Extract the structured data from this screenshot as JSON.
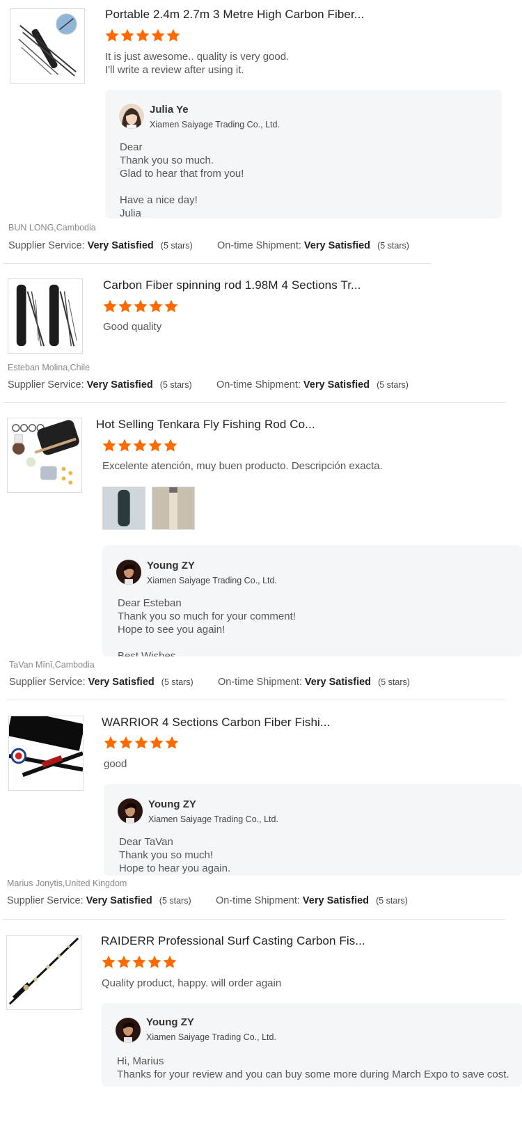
{
  "colors": {
    "star": "#ff6a00",
    "reply_bg": "#f5f6f8"
  },
  "reviews": [
    {
      "title": "Portable 2.4m 2.7m 3 Metre High Carbon Fiber...",
      "rating": 5,
      "comment": "It is just awesome.. quality is very good.\nI'll write a review after using it.",
      "reply": {
        "name": "Julia Ye",
        "company": "Xiamen Saiyage Trading Co., Ltd.",
        "text": "Dear\nThank you so much.\nGlad to hear that from you!\n\nHave a nice day!\nJulia"
      },
      "buyer": "BUN LONG,Cambodia",
      "supplier_label": "Supplier Service:",
      "supplier_value": "Very Satisfied",
      "supplier_stars": "(5 stars)",
      "shipment_label": "On-time Shipment:",
      "shipment_value": "Very Satisfied",
      "shipment_stars": "(5 stars)"
    },
    {
      "title": "Carbon Fiber spinning rod 1.98M 4 Sections Tr...",
      "rating": 5,
      "comment": "Good quality",
      "buyer": "Esteban Molina,Chile",
      "supplier_label": "Supplier Service:",
      "supplier_value": "Very Satisfied",
      "supplier_stars": "(5 stars)",
      "shipment_label": "On-time Shipment:",
      "shipment_value": "Very Satisfied",
      "shipment_stars": "(5 stars)"
    },
    {
      "title": "Hot Selling Tenkara Fly Fishing Rod Co...",
      "rating": 5,
      "comment": "Excelente atención, muy buen producto. Descripción exacta.",
      "reply": {
        "name": "Young ZY",
        "company": "Xiamen Saiyage Trading Co., Ltd.",
        "text": "Dear Esteban\nThank you so much for your comment!\nHope to see you again!\n\nBest Wishes"
      },
      "buyer": "TaVan Mīnī,Cambodia",
      "supplier_label": "Supplier Service:",
      "supplier_value": "Very Satisfied",
      "supplier_stars": "(5 stars)",
      "shipment_label": "On-time Shipment:",
      "shipment_value": "Very Satisfied",
      "shipment_stars": "(5 stars)"
    },
    {
      "title": "WARRIOR 4 Sections Carbon Fiber Fishi...",
      "rating": 5,
      "comment": "good",
      "reply": {
        "name": "Young ZY",
        "company": "Xiamen Saiyage Trading Co., Ltd.",
        "text": "Dear TaVan\nThank you so much!\nHope to hear you again."
      },
      "buyer": "Marius Jonytis,United Kingdom",
      "supplier_label": "Supplier Service:",
      "supplier_value": "Very Satisfied",
      "supplier_stars": "(5 stars)",
      "shipment_label": "On-time Shipment:",
      "shipment_value": "Very Satisfied",
      "shipment_stars": "(5 stars)"
    },
    {
      "title": "RAIDERR Professional Surf Casting Carbon Fis...",
      "rating": 5,
      "comment": "Quality product, happy. will order again",
      "reply": {
        "name": "Young ZY",
        "company": "Xiamen Saiyage Trading Co., Ltd.",
        "text": "Hi, Marius\nThanks for your review and you can buy some more during March Expo to save cost."
      }
    }
  ]
}
